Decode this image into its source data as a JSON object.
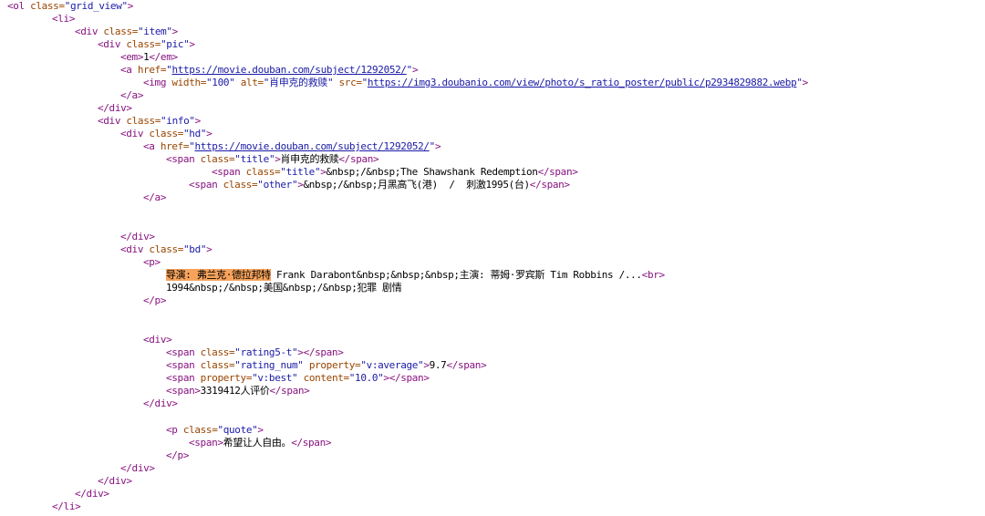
{
  "source": {
    "ol_class": "grid_view",
    "item_class": "item",
    "pic_class": "pic",
    "rank": "1",
    "subject_url": "https://movie.douban.com/subject/1292052/",
    "img_width": "100",
    "img_alt": "肖申克的救赎",
    "img_src": "https://img3.doubanio.com/view/photo/s_ratio_poster/public/p2934829882.webp",
    "info_class": "info",
    "hd_class": "hd",
    "title_class": "title",
    "title_zh": "肖申克的救赎",
    "title_en": "&nbsp;/&nbsp;The Shawshank Redemption",
    "other_class": "other",
    "other_text": "&nbsp;/&nbsp;月黑高飞(港)  /  刺激1995(台)",
    "bd_class": "bd",
    "director_highlight": "导演: 弗兰克·德拉邦特",
    "director_rest": " Frank Darabont&nbsp;&nbsp;&nbsp;主演: 蒂姆·罗宾斯 Tim Robbins /...",
    "year_line": "1994&nbsp;/&nbsp;美国&nbsp;/&nbsp;犯罪 剧情",
    "rating_star_class": "rating5-t",
    "rating_num_class": "rating_num",
    "rating_property": "v:average",
    "rating_value": "9.7",
    "best_property": "v:best",
    "best_content": "10.0",
    "votes": "3319412人评价",
    "quote_class": "quote",
    "quote_text": "希望让人自由。"
  }
}
